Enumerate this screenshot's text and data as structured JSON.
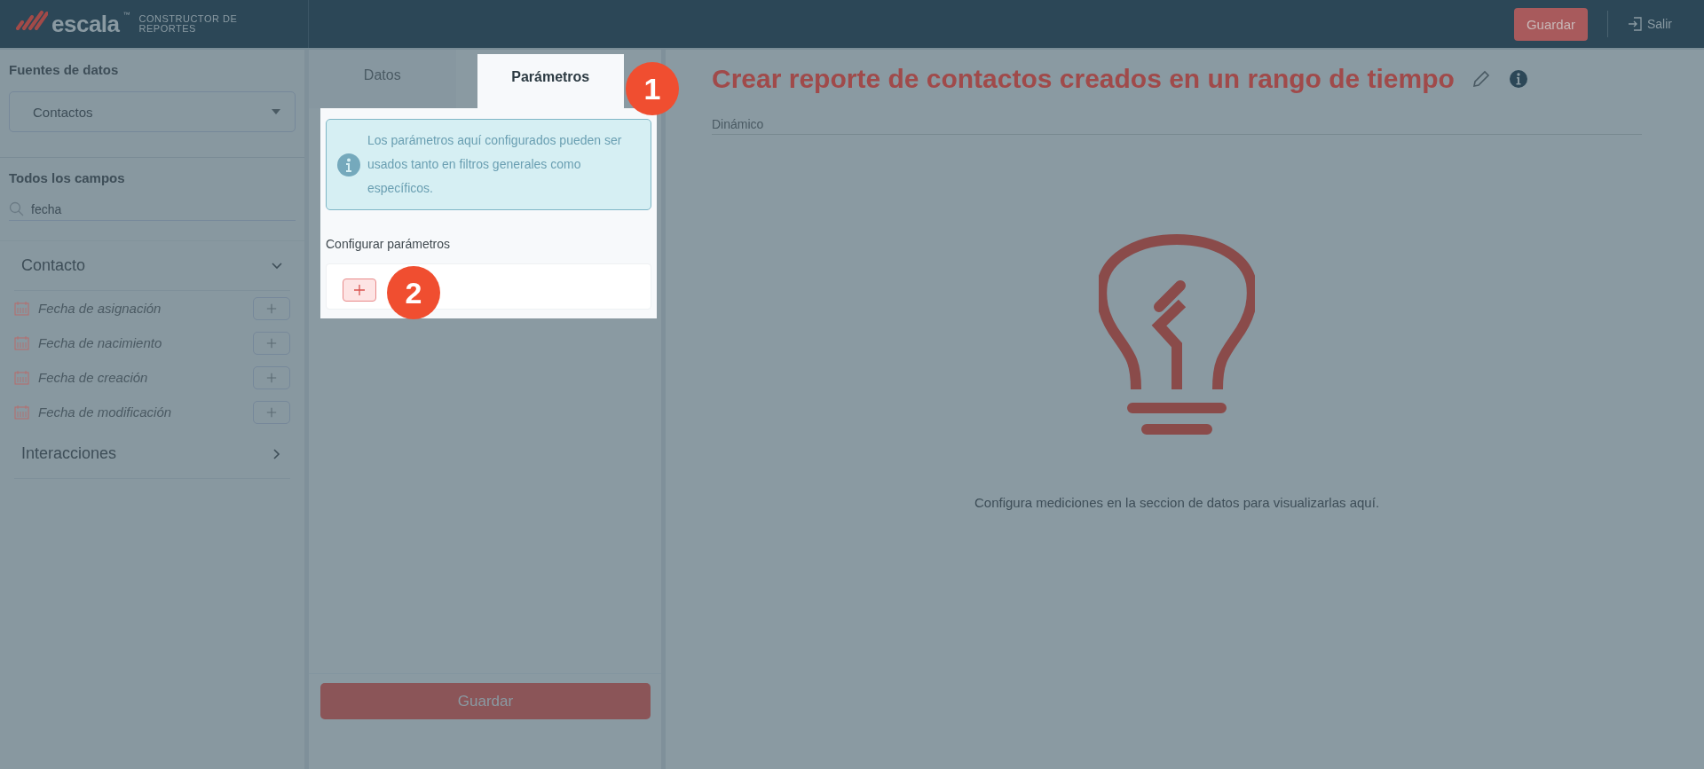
{
  "header": {
    "logo": "escala",
    "logo_mark": "™",
    "subtitle": "CONSTRUCTOR DE REPORTES",
    "save_button": "Guardar",
    "exit_button": "Salir"
  },
  "sidebar": {
    "sources_title": "Fuentes de datos",
    "source_select": "Contactos",
    "fields_title": "Todos los campos",
    "search_value": "fecha",
    "groups": [
      {
        "label": "Contacto",
        "expanded": true,
        "fields": [
          "Fecha de asignación",
          "Fecha de nacimiento",
          "Fecha de creación",
          "Fecha de modificación"
        ]
      },
      {
        "label": "Interacciones",
        "expanded": false
      }
    ]
  },
  "panel": {
    "tabs": [
      {
        "label": "Datos",
        "selected": false
      },
      {
        "label": "Parámetros",
        "selected": true
      }
    ],
    "info": "Los parámetros aquí configurados pueden ser usados tanto en filtros generales como específicos.",
    "section_label": "Configurar parámetros",
    "save_button": "Guardar"
  },
  "report": {
    "title": "Crear reporte de contactos creados en un rango de tiempo",
    "type_label": "Dinámico",
    "empty_message": "Configura mediciones en la seccion de datos para visualizarlas aquí."
  },
  "tutorial_badges": [
    "1",
    "2"
  ]
}
